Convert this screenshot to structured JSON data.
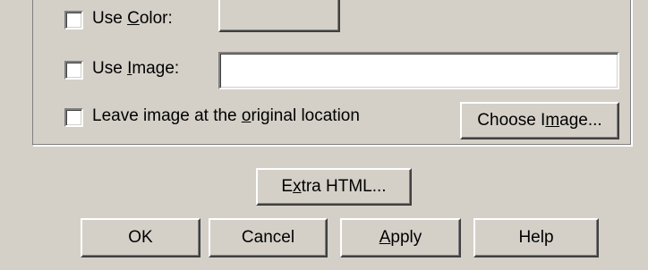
{
  "group": {
    "use_color": {
      "checked": false,
      "label_pre": "Use ",
      "label_accel": "C",
      "label_post": "olor:"
    },
    "use_image": {
      "checked": false,
      "label_pre": "Use ",
      "label_accel": "I",
      "label_post": "mage:",
      "value": ""
    },
    "leave_image": {
      "checked": false,
      "label_pre": "Leave image at the ",
      "label_accel": "o",
      "label_post": "riginal location"
    },
    "choose_image": {
      "label_pre": "Choose I",
      "label_accel": "m",
      "label_post": "age..."
    }
  },
  "extra_html": {
    "label_pre": "E",
    "label_accel": "x",
    "label_post": "tra HTML..."
  },
  "buttons": {
    "ok": "OK",
    "cancel": "Cancel",
    "apply_accel": "A",
    "apply_post": "pply",
    "help": "Help"
  },
  "colors": {
    "dialog_bg": "#d4d0c8",
    "field_bg": "#ffffff"
  }
}
